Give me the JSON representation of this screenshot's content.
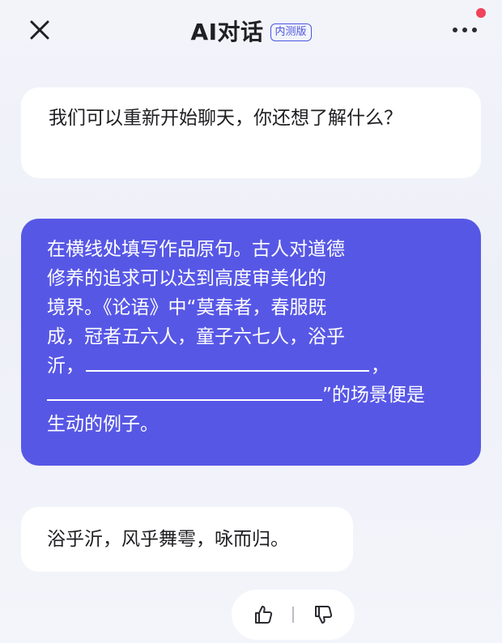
{
  "header": {
    "title": "AI对话",
    "badge": "内测版",
    "close_icon": "close-icon",
    "more_icon": "more-dots-icon"
  },
  "messages": {
    "ai_first": "我们可以重新开始聊天，你还想了解什么？",
    "user": {
      "line1": "在横线处填写作品原句。古人对道德",
      "line2": "修养的追求可以达到高度审美化的",
      "line3": "境界。《论语》中“莫春者，春服既",
      "line4": "成，冠者五六人，童子六七人，浴乎",
      "line5_prefix": "沂，",
      "line5_suffix": "，",
      "line6_suffix": "”的场景便是",
      "line7": "生动的例子。"
    },
    "ai_answer": "浴乎沂，风乎舞雩，咏而归。"
  },
  "feedback": {
    "like_icon": "thumbs-up-icon",
    "dislike_icon": "thumbs-down-icon"
  },
  "colors": {
    "accent": "#5757e6",
    "badge": "#4b55e0",
    "notification": "#f0425a"
  }
}
